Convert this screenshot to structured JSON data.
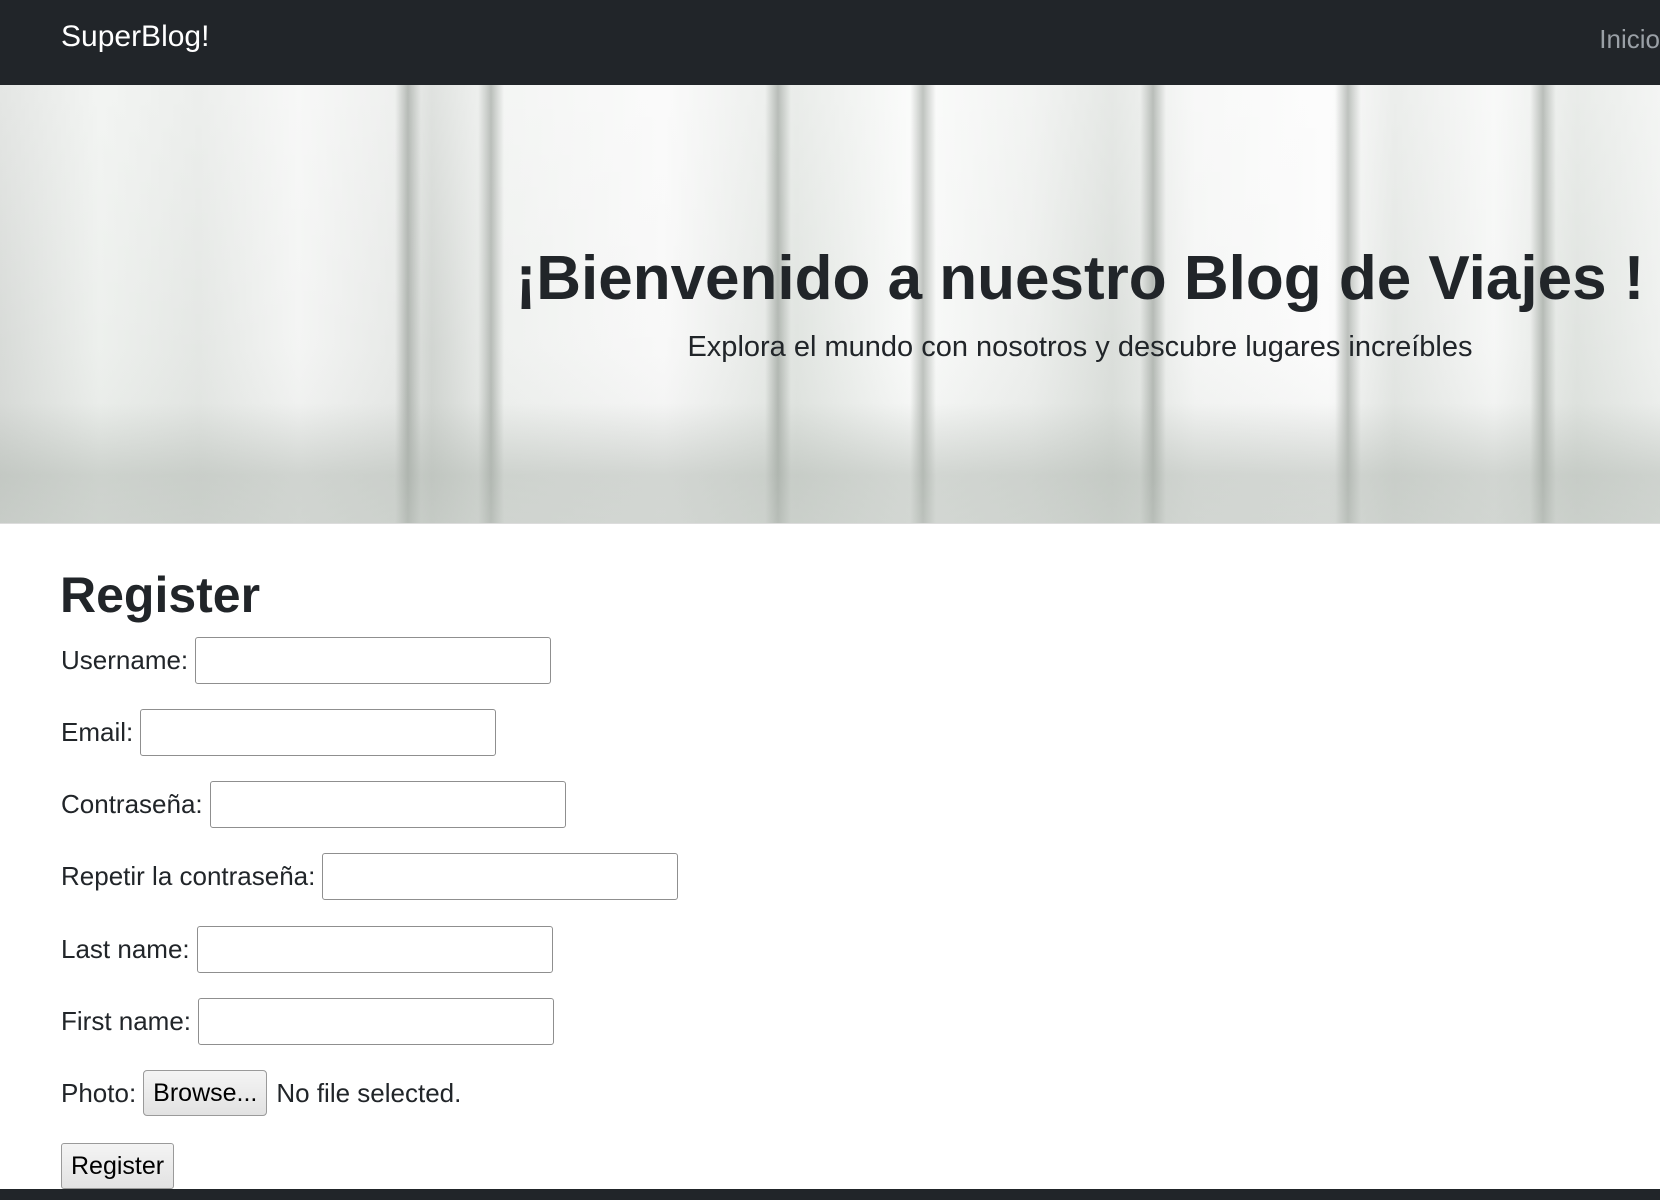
{
  "navbar": {
    "brand": "SuperBlog!",
    "links": [
      {
        "label": "Inicio"
      }
    ]
  },
  "hero": {
    "title": "¡Bienvenido a nuestro Blog de Viajes !",
    "subtitle": "Explora el mundo con nosotros y descubre lugares increíbles"
  },
  "form": {
    "title": "Register",
    "fields": [
      {
        "label": "Username:",
        "value": ""
      },
      {
        "label": "Email:",
        "value": ""
      },
      {
        "label": "Contraseña:",
        "value": ""
      },
      {
        "label": "Repetir la contraseña:",
        "value": ""
      },
      {
        "label": "Last name:",
        "value": ""
      },
      {
        "label": "First name:",
        "value": ""
      }
    ],
    "photo": {
      "label": "Photo:",
      "button_label": "Browse...",
      "status": "No file selected."
    },
    "submit_label": "Register"
  }
}
